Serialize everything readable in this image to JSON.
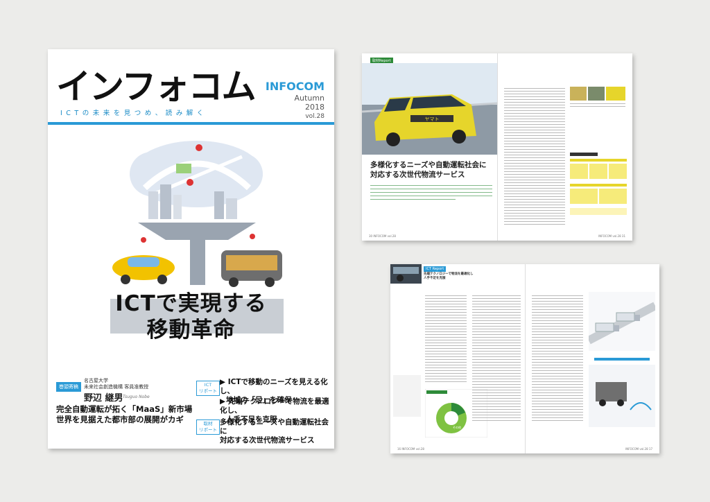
{
  "cover": {
    "masthead": "インフォコム",
    "tagline": "ICTの未来を見つめ、読み解く",
    "brand": "INFOCOM",
    "season": "Autumn",
    "year": "2018",
    "issue": "vol.28",
    "headline_line1": "ICTで実現する",
    "headline_line2": "移動革命",
    "feature": {
      "tag": "巻頭寄稿",
      "affiliation1": "名古屋大学",
      "affiliation2": "未来社会創造機構 客員准教授",
      "author": "野辺 継男",
      "author_latin": "Tsuguo Nobe",
      "title_line1": "完全自動運転が拓く「MaaS」新市場",
      "title_line2": "世界を見据えた都市部の展開がカギ"
    },
    "ict_report": {
      "tag_line1": "ICT",
      "tag_line2": "リポート",
      "item1_line1": "▶ ICTで移動のニーズを見える化し、",
      "item1_line2": "地域の「足」を確保",
      "item2_line1": "▶ 先端テクノロジーで物流を最適化し、",
      "item2_line2": "人手不足を克服"
    },
    "coverage_report": {
      "tag_line1": "取材",
      "tag_line2": "リポート",
      "title_line1": "多様化するニーズや自動運転社会に",
      "title_line2": "対応する次世代物流サービス"
    }
  },
  "spread1": {
    "section_tag": "取材Report",
    "van_sign": "ヤマト",
    "title_line1": "多様化するニーズや自動運転社会に",
    "title_line2": "対応する次世代物流サービス",
    "folio_left": "30  INFOCOM  vol.28",
    "folio_right": "INFOCOM  vol.28  31"
  },
  "spread2": {
    "section_tag": "ICT Report",
    "title_line1": "先端テクノロジーで物流を最適化し",
    "title_line2": "人手不足を克服",
    "pie_label": "その他",
    "folio_left": "16  INFOCOM  vol.28",
    "folio_right": "INFOCOM  vol.28  17"
  },
  "colors": {
    "accent_blue": "#2a9ad6",
    "accent_green": "#2e8b3a",
    "taxi_yellow": "#f2c200"
  }
}
